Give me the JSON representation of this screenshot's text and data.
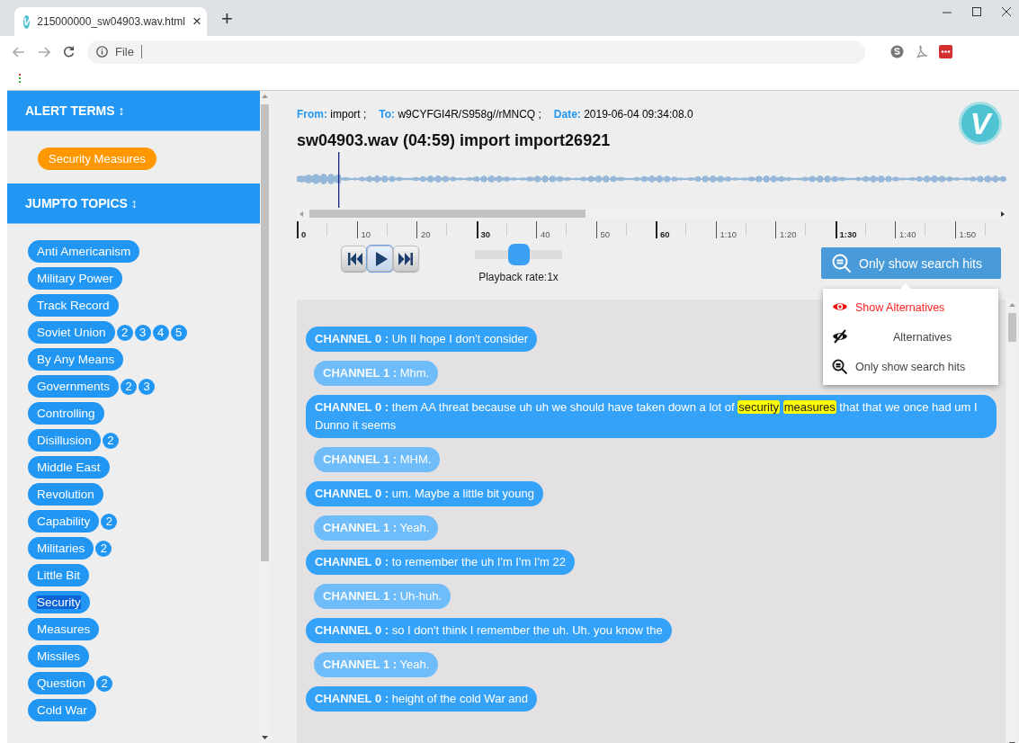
{
  "browser": {
    "tab": {
      "icon_letter": "V",
      "title": "215000000_sw04903.wav.html",
      "close": "×"
    },
    "new_tab": "+",
    "address": {
      "scheme": "File"
    }
  },
  "sidebar": {
    "sections": [
      {
        "kind": "alerts",
        "title": "ALERT TERMS",
        "toggle": "↕",
        "tags": [
          {
            "label": "Security Measures",
            "selected": false
          }
        ]
      },
      {
        "kind": "topics",
        "title": "JUMPTO TOPICS",
        "toggle": "↕",
        "tags": [
          {
            "label": "Anti Americanism",
            "selected": false
          },
          {
            "label": "Military Power",
            "selected": false
          },
          {
            "label": "Track Record",
            "selected": false
          },
          {
            "label": "Soviet Union",
            "extras": [
              "2",
              "3",
              "4",
              "5"
            ],
            "selected": false
          },
          {
            "label": "By Any Means",
            "selected": false
          },
          {
            "label": "Governments",
            "extras": [
              "2",
              "3"
            ],
            "selected": false
          },
          {
            "label": "Controlling",
            "selected": false
          },
          {
            "label": "Disillusion",
            "extras": [
              "2"
            ],
            "selected": false
          },
          {
            "label": "Middle East",
            "selected": false
          },
          {
            "label": "Revolution",
            "selected": false
          },
          {
            "label": "Capability",
            "extras": [
              "2"
            ],
            "selected": false
          },
          {
            "label": "Militaries",
            "extras": [
              "2"
            ],
            "selected": false
          },
          {
            "label": "Little Bit",
            "selected": false
          },
          {
            "label": "Security",
            "selected": true
          },
          {
            "label": "Measures",
            "selected": false
          },
          {
            "label": "Missiles",
            "selected": false
          },
          {
            "label": "Question",
            "extras": [
              "2"
            ],
            "selected": false
          },
          {
            "label": "Cold War",
            "selected": false
          }
        ]
      }
    ]
  },
  "header": {
    "meta": [
      {
        "label": "From:",
        "value": "import ;"
      },
      {
        "label": "To:",
        "value": "w9CYFGI4R/S958g//rMNCQ ;"
      },
      {
        "label": "Date:",
        "value": "2019-06-04 09:34:08.0"
      }
    ],
    "title": "sw04903.wav (04:59) import import26921",
    "logo_letter": "V"
  },
  "timeline": {
    "ticks": [
      {
        "label": "0",
        "major": true
      },
      {
        "label": "10",
        "major": false
      },
      {
        "label": "20",
        "major": false
      },
      {
        "label": "30",
        "major": true
      },
      {
        "label": "40",
        "major": false
      },
      {
        "label": "50",
        "major": false
      },
      {
        "label": "60",
        "major": true
      },
      {
        "label": "1:10",
        "major": false
      },
      {
        "label": "1:20",
        "major": false
      },
      {
        "label": "1:30",
        "major": true
      },
      {
        "label": "1:40",
        "major": false
      },
      {
        "label": "1:50",
        "major": false
      }
    ]
  },
  "transport": [
    {
      "kind": "prev",
      "focused": false
    },
    {
      "kind": "play",
      "focused": true
    },
    {
      "kind": "next",
      "focused": false
    }
  ],
  "playback_rate": {
    "level": 0.5,
    "label": "Playback rate:1x"
  },
  "filter": {
    "label": "Only show search hits",
    "menu": [
      {
        "kind": "show",
        "label": "Show Alternatives",
        "hovered": true
      },
      {
        "kind": "hide",
        "label": "Alternatives",
        "hovered": false
      },
      {
        "kind": "hits",
        "label": "Only show search hits",
        "hovered": false
      }
    ]
  },
  "messages": [
    {
      "kind": "ch0",
      "speaker": "CHANNEL 0 :",
      "parts": [
        {
          "text": "Uh II hope I don't consider",
          "hit": false
        }
      ]
    },
    {
      "kind": "ch1",
      "speaker": "CHANNEL 1 :",
      "parts": [
        {
          "text": "Mhm.",
          "hit": false
        }
      ]
    },
    {
      "kind": "ch0",
      "speaker": "CHANNEL 0 :",
      "parts": [
        {
          "text": "them AA threat because uh uh we should have taken down a lot of",
          "hit": false
        },
        {
          "text": "security",
          "hit": true
        },
        {
          "text": "measures",
          "hit": true
        },
        {
          "text": "that that we once had um I Dunno it seems",
          "hit": false
        }
      ]
    },
    {
      "kind": "ch1",
      "speaker": "CHANNEL 1 :",
      "parts": [
        {
          "text": "MHM.",
          "hit": false
        }
      ]
    },
    {
      "kind": "ch0",
      "speaker": "CHANNEL 0 :",
      "parts": [
        {
          "text": "um. Maybe a little bit young",
          "hit": false
        }
      ]
    },
    {
      "kind": "ch1",
      "speaker": "CHANNEL 1 :",
      "parts": [
        {
          "text": "Yeah.",
          "hit": false
        }
      ]
    },
    {
      "kind": "ch0",
      "speaker": "CHANNEL 0 :",
      "parts": [
        {
          "text": "to remember the uh I'm I'm I'm 22",
          "hit": false
        }
      ]
    },
    {
      "kind": "ch1",
      "speaker": "CHANNEL 1 :",
      "parts": [
        {
          "text": "Uh-huh.",
          "hit": false
        }
      ]
    },
    {
      "kind": "ch0",
      "speaker": "CHANNEL 0 :",
      "parts": [
        {
          "text": "so I don't think I remember the uh. Uh. you know the",
          "hit": false
        }
      ]
    },
    {
      "kind": "ch1",
      "speaker": "CHANNEL 1 :",
      "parts": [
        {
          "text": "Yeah.",
          "hit": false
        }
      ]
    },
    {
      "kind": "ch0",
      "speaker": "CHANNEL 0 :",
      "parts": [
        {
          "text": "height of the cold War and",
          "hit": false
        }
      ]
    }
  ]
}
